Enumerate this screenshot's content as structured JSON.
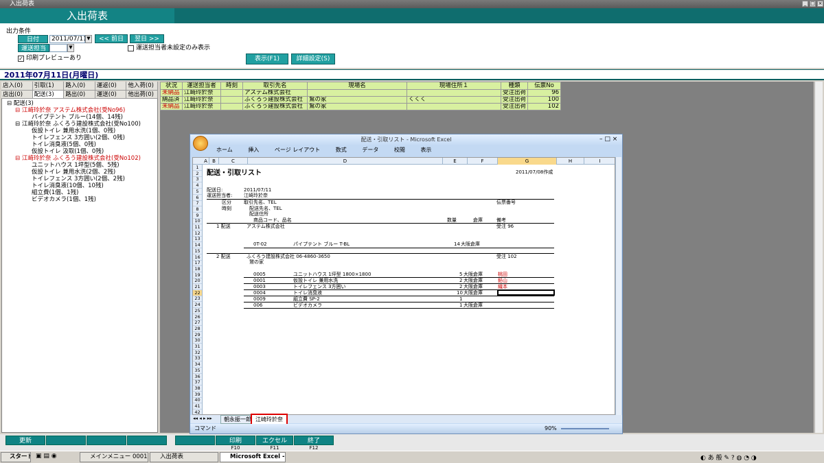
{
  "window": {
    "title": "入出荷表"
  },
  "form": {
    "title": "入出荷表"
  },
  "conditions": {
    "label": "出力条件",
    "date_label": "日付",
    "date_value": "2011/07/11",
    "prev_label": "<< 前日",
    "next_label": "翌日 >>",
    "staff_label": "運送担当者",
    "unset_only_label": "運送担当者未設定のみ表示",
    "preview_label": "印刷プレビューあり",
    "show_label": "表示(F1)",
    "detail_label": "詳細設定(S)"
  },
  "date_header": "2011年07月11日(月曜日)",
  "tabs": [
    "店入(0)",
    "引取(1)",
    "路入(0)",
    "運返(0)",
    "他入荷(0)",
    "店出(0)",
    "配送(3)",
    "路出(0)",
    "運送(0)",
    "他出荷(0)"
  ],
  "tree": [
    {
      "text": "⊟ 配送(3)",
      "red": false
    },
    {
      "text": "⊟ 江崎玲於奈 アステム株式会社(受No96)",
      "red": true
    },
    {
      "text": "パイプテント ブルー(14個、14残)",
      "red": false
    },
    {
      "text": "⊟ 江崎玲於奈 ふくろう建設株式会社(受No100)",
      "red": false
    },
    {
      "text": "仮設トイレ 兼用水洗(1個、0残)",
      "red": false
    },
    {
      "text": "トイレフェンス 3方囲い(2個、0残)",
      "red": false
    },
    {
      "text": "トイレ消臭液(5個、0残)",
      "red": false
    },
    {
      "text": "仮設トイレ 汲取(1個、0残)",
      "red": false
    },
    {
      "text": "⊟ 江崎玲於奈 ふくろう建設株式会社(受No102)",
      "red": true
    },
    {
      "text": "ユニットハウス 1坪型(5個、5残)",
      "red": false
    },
    {
      "text": "仮設トイレ 兼用水洗(2個、2残)",
      "red": false
    },
    {
      "text": "トイレフェンス 3方囲い(2個、2残)",
      "red": false
    },
    {
      "text": "トイレ消臭液(10個、10残)",
      "red": false
    },
    {
      "text": "組立費(1個、1残)",
      "red": false
    },
    {
      "text": "ビデオカメラ(1個、1残)",
      "red": false
    }
  ],
  "grid": {
    "headers": [
      "状況",
      "運送担当者",
      "時刻",
      "取引先名",
      "現場名",
      "現場住所１",
      "種類",
      "伝票No"
    ],
    "rows": [
      {
        "status": "未納品",
        "status_red": true,
        "staff": "江崎玲於奈",
        "time": "",
        "client": "アステム株式会社",
        "site": "",
        "address": "",
        "type": "受注出荷",
        "no": "96"
      },
      {
        "status": "納品済",
        "status_red": false,
        "staff": "江崎玲於奈",
        "time": "",
        "client": "ふくろう建設株式会社",
        "site": "鷲の家",
        "address": "くくく",
        "type": "受注出荷",
        "no": "100"
      },
      {
        "status": "未納品",
        "status_red": true,
        "staff": "江崎玲於奈",
        "time": "",
        "client": "ふくろう建設株式会社",
        "site": "鷲の家",
        "address": "",
        "type": "受注出荷",
        "no": "102"
      }
    ]
  },
  "excel": {
    "title": "配送・引取リスト - Microsoft Excel",
    "ribbon": [
      "ホーム",
      "挿入",
      "ページ レイアウト",
      "数式",
      "データ",
      "校閲",
      "表示"
    ],
    "columns": [
      "A",
      "B",
      "C",
      "D",
      "E",
      "F",
      "G",
      "H",
      "I"
    ],
    "rows": [
      "1",
      "2",
      "3",
      "4",
      "5",
      "6",
      "7",
      "8",
      "9",
      "10",
      "11",
      "12",
      "13",
      "14",
      "15",
      "16",
      "17",
      "18",
      "19",
      "20",
      "21",
      "22",
      "23",
      "24",
      "25",
      "26",
      "27",
      "28",
      "29",
      "30",
      "31",
      "32",
      "33",
      "34",
      "35",
      "36",
      "37",
      "38",
      "39",
      "40",
      "41",
      "42"
    ],
    "heading": "配送・引取リスト",
    "created": "2011/07/08作成",
    "ship_date_label": "配送日:",
    "ship_date": "2011/07/11",
    "staff_label": "運送担当者:",
    "staff": "江崎玲於奈",
    "h_kubun": "区分",
    "h_client": "取引先名、TEL",
    "h_slip": "伝票番号",
    "h_time": "時刻",
    "h_dest": "配送先名、TEL",
    "h_addr": "配送住所",
    "h_code": "商品コード、品名",
    "h_qty": "数量",
    "h_wh": "倉庫",
    "h_note": "備考",
    "r1_kubun": "1 配送",
    "r1_client": "アステム株式会社",
    "r1_slip": "受注 96",
    "r1_code": "0T-02",
    "r1_item": "パイプテント ブルー T-BL",
    "r1_qty": "14",
    "r1_wh": "大阪倉庫",
    "r2_kubun": "2 配送",
    "r2_client": "ふくろう建設株式会社 06-4860-3650",
    "r2_slip": "受注 102",
    "r2_dest": "鷲の家",
    "items": [
      {
        "code": "0005",
        "name": "ユニットハウス 1坪型 1800×1800",
        "qty": "5",
        "wh": "大阪倉庫",
        "note": "桃田"
      },
      {
        "code": "0001",
        "name": "仮設トイレ 兼用水洗",
        "qty": "2",
        "wh": "大阪倉庫",
        "note": "鉛山"
      },
      {
        "code": "0003",
        "name": "トイレフェンス 3方囲い",
        "qty": "2",
        "wh": "大阪倉庫",
        "note": "織本"
      },
      {
        "code": "0004",
        "name": "トイレ消臭液",
        "qty": "10",
        "wh": "大阪倉庫",
        "note": ""
      },
      {
        "code": "0009",
        "name": "組立費 SP-2",
        "qty": "1",
        "wh": "",
        "note": ""
      },
      {
        "code": "006",
        "name": "ビデオカメラ",
        "qty": "1",
        "wh": "大阪倉庫",
        "note": ""
      }
    ],
    "sheet_tabs": [
      "朝永振一郎",
      "江崎玲於奈"
    ],
    "status": "コマンド",
    "zoom": "90%"
  },
  "func": {
    "update": "更新",
    "print": "印刷",
    "print_key": "F10",
    "excel": "エクセル",
    "excel_key": "F11",
    "exit": "終了",
    "exit_key": "F12"
  },
  "taskbar": {
    "start": "スタート",
    "tasks": [
      "メインメニュー 0001 梨し...",
      "入出荷表",
      "Microsoft Excel - ..."
    ]
  }
}
